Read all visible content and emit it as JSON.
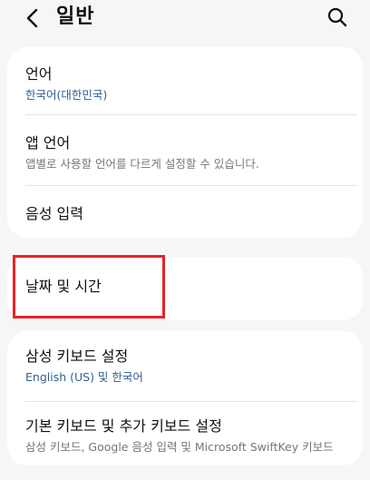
{
  "header": {
    "title": "일반",
    "back_icon": "chevron-left-icon",
    "search_icon": "search-icon"
  },
  "sections": [
    {
      "items": [
        {
          "title": "언어",
          "subtitle": "한국어(대한민국)"
        },
        {
          "title": "앱 언어",
          "subtitle": "앱별로 사용할 언어를 다르게 설정할 수 있습니다."
        },
        {
          "title": "음성 입력"
        }
      ]
    },
    {
      "items": [
        {
          "title": "날짜 및 시간"
        }
      ]
    },
    {
      "items": [
        {
          "title": "삼성 키보드 설정",
          "subtitle": "English (US) 및 한국어"
        },
        {
          "title": "기본 키보드 및 추가 키보드 설정",
          "subtitle": "삼성 키보드, Google 음성 입력 및 Microsoft SwiftKey 키보드"
        }
      ]
    }
  ],
  "colors": {
    "accent_subtitle": "#2f5f96",
    "highlight_box": "#e8222a",
    "background": "#f6f6f6",
    "card": "#ffffff"
  }
}
